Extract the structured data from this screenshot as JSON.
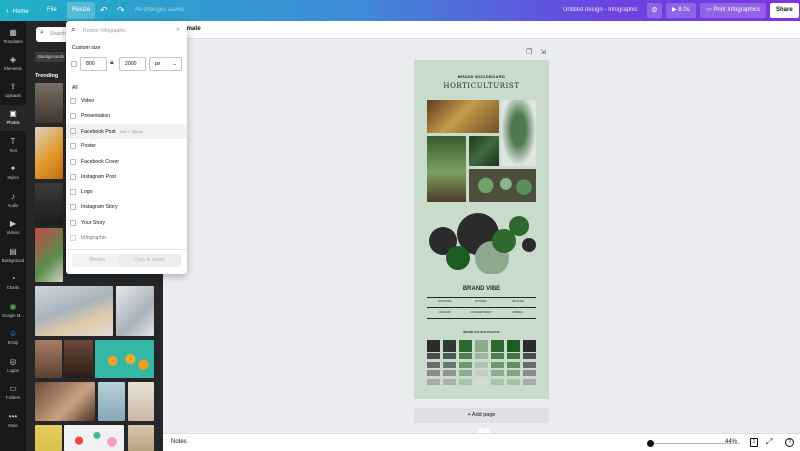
{
  "topbar": {
    "home": "Home",
    "file": "File",
    "resize": "Resize",
    "undo_icon": "undo-icon",
    "redo_icon": "redo-icon",
    "save_status": "All changes saved",
    "doc_title": "Untitled design - Infographic",
    "timer": "8.0s",
    "print": "Print Infographics",
    "share": "Share"
  },
  "rail": [
    {
      "icon": "templates-icon",
      "glyph": "▦",
      "label": "Templates"
    },
    {
      "icon": "elements-icon",
      "glyph": "◈",
      "label": "Elements"
    },
    {
      "icon": "uploads-icon",
      "glyph": "⇪",
      "label": "Uploads"
    },
    {
      "icon": "photos-icon",
      "glyph": "▣",
      "label": "Photos"
    },
    {
      "icon": "text-icon",
      "glyph": "T",
      "label": "Text"
    },
    {
      "icon": "styles-icon",
      "glyph": "✦",
      "label": "Styles"
    },
    {
      "icon": "audio-icon",
      "glyph": "♪",
      "label": "Audio"
    },
    {
      "icon": "videos-icon",
      "glyph": "▶",
      "label": "Videos"
    },
    {
      "icon": "background-icon",
      "glyph": "▤",
      "label": "Background"
    },
    {
      "icon": "charts-icon",
      "glyph": "◔",
      "label": "Charts"
    },
    {
      "icon": "google-maps-icon",
      "glyph": "◉",
      "label": "Google M..."
    },
    {
      "icon": "emoji-icon",
      "glyph": "☺",
      "label": "Emoji"
    },
    {
      "icon": "logos-icon",
      "glyph": "◎",
      "label": "Logos"
    },
    {
      "icon": "folders-icon",
      "glyph": "▭",
      "label": "Folders"
    },
    {
      "icon": "more-icon",
      "glyph": "•••",
      "label": "More"
    }
  ],
  "panel": {
    "search_placeholder": "Search",
    "chip": "Backgrounds",
    "trending": "Trending"
  },
  "subbar": {
    "animate": "Animate"
  },
  "resize_menu": {
    "search_placeholder": "Resize Infographic",
    "custom_size_label": "Custom size",
    "width": "800",
    "height": "2000",
    "unit": "px",
    "section_all": "All",
    "options": [
      {
        "label": "Video",
        "sub": ""
      },
      {
        "label": "Presentation",
        "sub": ""
      },
      {
        "label": "Facebook Post",
        "sub": "940 × 788 px"
      },
      {
        "label": "Poster",
        "sub": ""
      },
      {
        "label": "Facebook Cover",
        "sub": ""
      },
      {
        "label": "Instagram Post",
        "sub": ""
      },
      {
        "label": "Logo",
        "sub": ""
      },
      {
        "label": "Instagram Story",
        "sub": ""
      },
      {
        "label": "Your Story",
        "sub": ""
      },
      {
        "label": "Infographic",
        "sub": ""
      }
    ],
    "resize_button": "Resize",
    "copy_resize_button": "Copy & resize"
  },
  "design": {
    "kicker": "BRAND MOODBOARD",
    "title": "HORTICULTURIST",
    "brand_vibe": "BRAND VIBE",
    "vibe_words": [
      "EARTHING",
      "NATURAL",
      "WILDLIFE",
      "ORGANIC",
      "CONTEMPORARY",
      "MINIMAL"
    ],
    "palette_title": "BRAND COLOUR PALETTE",
    "palette_colors": [
      "#2b2b2b",
      "#2f3a33",
      "#2e6a2f",
      "#8ea88e",
      "#2e6a2f",
      "#1e5c23",
      "#2b2b2b"
    ]
  },
  "canvas": {
    "add_page": "+ Add page"
  },
  "bottombar": {
    "notes": "Notes",
    "zoom": "44%",
    "page_indicator": "1"
  },
  "colors": {
    "accent": "#7d35e3",
    "page_bg": "#c9dccb"
  }
}
